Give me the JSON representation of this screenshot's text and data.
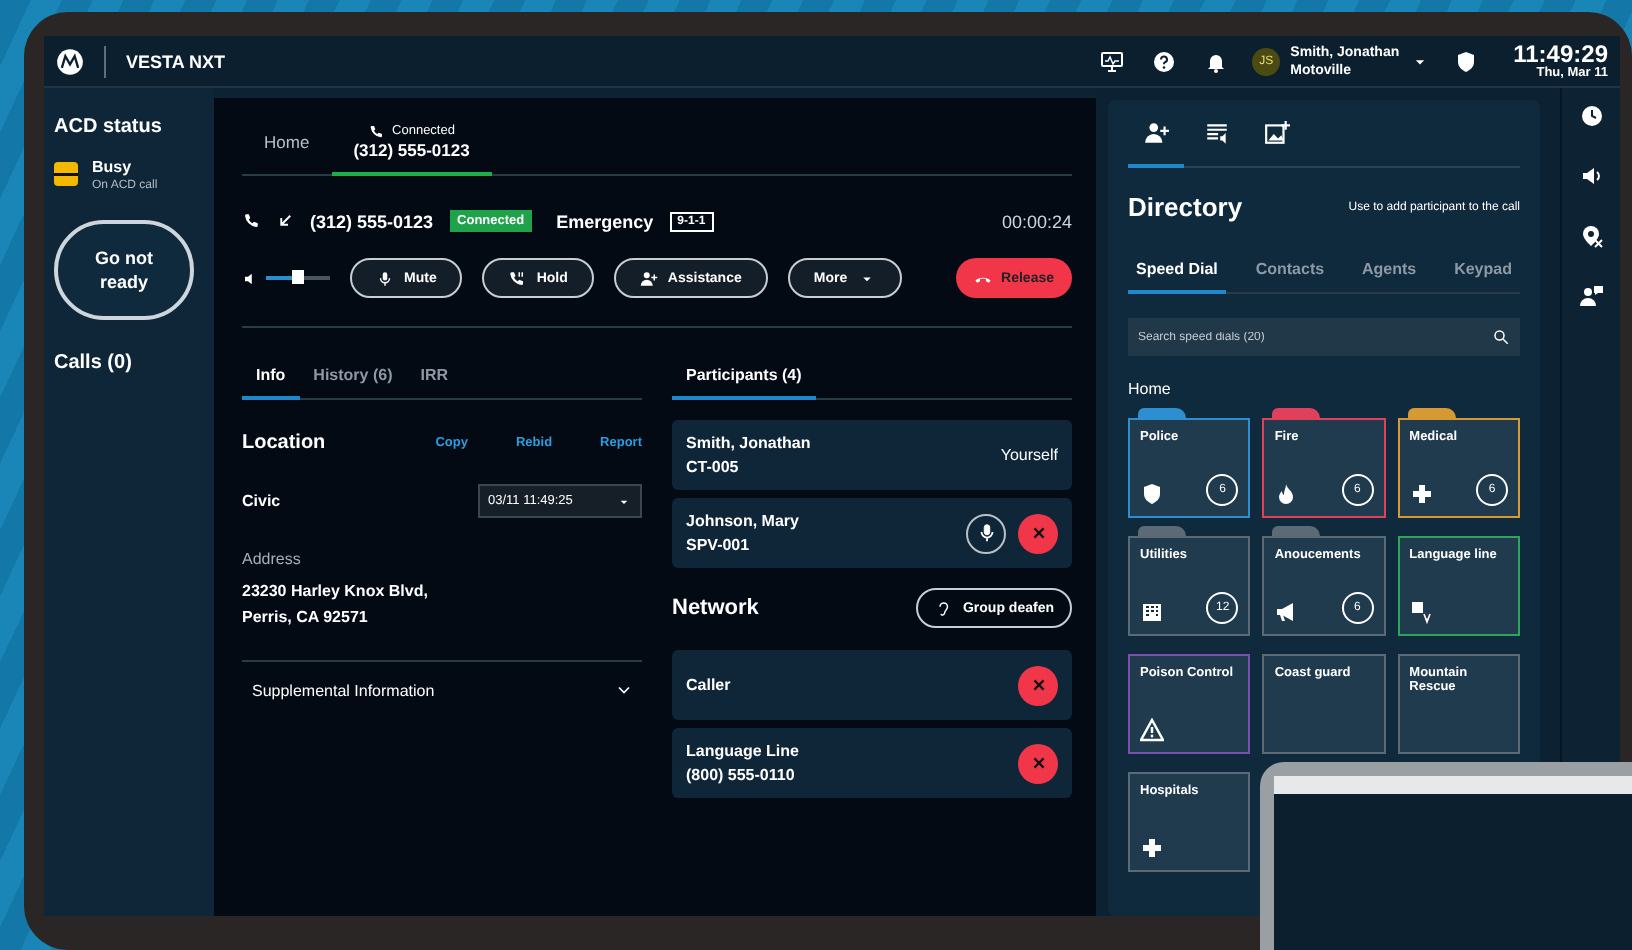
{
  "header": {
    "app_name": "VESTA NXT",
    "tools": [
      {
        "kind": "monitor"
      },
      {
        "kind": "help"
      },
      {
        "kind": "bell"
      }
    ],
    "user": {
      "initials": "JS",
      "name": "Smith, Jonathan",
      "location": "Motoville"
    },
    "time": "11:49:29",
    "date": "Thu, Mar 11"
  },
  "sidebar": {
    "title": "ACD status",
    "status": {
      "label": "Busy",
      "detail": "On ACD call"
    },
    "action": "Go not ready",
    "calls": "Calls (0)"
  },
  "call_tabs": [
    {
      "label": "Home",
      "selected": false
    },
    {
      "status": "Connected",
      "label": "(312) 555-0123",
      "selected": true
    }
  ],
  "call": {
    "number": "(312) 555-0123",
    "state": "Connected",
    "type": "Emergency",
    "code": "9-1-1",
    "timer": "00:00:24",
    "volume": {
      "level": 0.5
    }
  },
  "controls": [
    {
      "label": "Mute",
      "kind": "mic"
    },
    {
      "label": "Hold",
      "kind": "hold"
    },
    {
      "label": "Assistance",
      "kind": "add-person"
    },
    {
      "label": "More",
      "kind": "caret"
    }
  ],
  "release": "Release",
  "info_tabs": [
    {
      "label": "Info",
      "selected": true
    },
    {
      "label": "History (6)",
      "selected": false
    },
    {
      "label": "IRR",
      "selected": false
    }
  ],
  "location": {
    "title": "Location",
    "actions": [
      "Copy",
      "Rebid",
      "Report"
    ],
    "civic_label": "Civic",
    "timestamp": "03/11 11:49:25",
    "address_label": "Address",
    "address_lines": [
      "23230 Harley Knox Blvd,",
      "Perris, CA 92571"
    ],
    "supplemental": "Supplemental Information"
  },
  "participants": {
    "tab": "Participants (4)",
    "items": [
      {
        "name": "Smith, Jonathan",
        "id": "CT-005",
        "kind": "self",
        "note": "Yourself"
      },
      {
        "name": "Johnson, Mary",
        "id": "SPV-001",
        "kind": "remote"
      }
    ]
  },
  "network": {
    "title": "Network",
    "action": "Group deafen",
    "items": [
      {
        "name": "Caller"
      },
      {
        "name": "Language Line",
        "detail": "(800) 555-0110"
      }
    ]
  },
  "directory": {
    "tool_tabs": [
      {
        "kind": "add-person",
        "selected": true
      },
      {
        "kind": "list-audio",
        "selected": false
      },
      {
        "kind": "image-add",
        "selected": false
      }
    ],
    "title": "Directory",
    "hint": "Use to add participant to the call",
    "tabs": [
      {
        "label": "Speed Dial",
        "selected": true
      },
      {
        "label": "Contacts",
        "selected": false
      },
      {
        "label": "Agents",
        "selected": false
      },
      {
        "label": "Keypad",
        "selected": false
      }
    ],
    "search_placeholder": "Search speed dials (20)",
    "section": "Home",
    "tiles": [
      {
        "label": "Police",
        "kind": "shield",
        "count": "6",
        "folder": true,
        "color": "#2d8fd0"
      },
      {
        "label": "Fire",
        "kind": "flame",
        "count": "6",
        "folder": true,
        "color": "#e0405a"
      },
      {
        "label": "Medical",
        "kind": "cross",
        "count": "6",
        "folder": true,
        "color": "#d69a34"
      },
      {
        "label": "Utilities",
        "kind": "building",
        "count": "12",
        "folder": true,
        "color": "#5c6a78"
      },
      {
        "label": "Anoucements",
        "kind": "megaphone",
        "count": "6",
        "folder": true,
        "color": "#5c6a78"
      },
      {
        "label": "Language line",
        "kind": "translate",
        "folder": false,
        "color": "#2fa45a"
      },
      {
        "label": "Poison Control",
        "kind": "warning",
        "folder": false,
        "color": "#7a4fb0"
      },
      {
        "label": "Coast guard",
        "kind": "none",
        "folder": false,
        "color": "#5c6a78"
      },
      {
        "label": "Mountain Rescue",
        "kind": "none",
        "folder": false,
        "color": "#5c6a78"
      },
      {
        "label": "Hospitals",
        "kind": "cross",
        "folder": false,
        "color": "#5c6a78"
      }
    ]
  },
  "rail": [
    {
      "kind": "clock"
    },
    {
      "kind": "speaker"
    },
    {
      "kind": "location-off"
    },
    {
      "kind": "person-chat"
    }
  ]
}
